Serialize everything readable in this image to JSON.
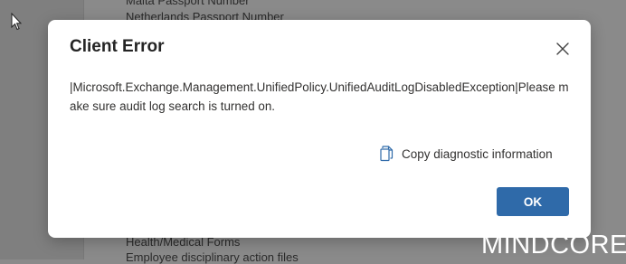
{
  "background": {
    "list_items": [
      "Malta Passport Number",
      "Netherlands Passport Number",
      "Health/Medical Forms",
      "Employee disciplinary action files"
    ]
  },
  "dialog": {
    "title": "Client Error",
    "message": "|Microsoft.Exchange.Management.UnifiedPolicy.UnifiedAuditLogDisabledException|Please make sure audit log search is turned on.",
    "copy_label": "Copy diagnostic information",
    "ok_label": "OK",
    "close_icon": "close-icon",
    "copy_icon": "copy-icon"
  },
  "watermark": {
    "text": "MINDCORE"
  },
  "colors": {
    "accent": "#2f6aa9",
    "dialog_bg": "#ffffff",
    "overlay": "#8a8a8a"
  }
}
